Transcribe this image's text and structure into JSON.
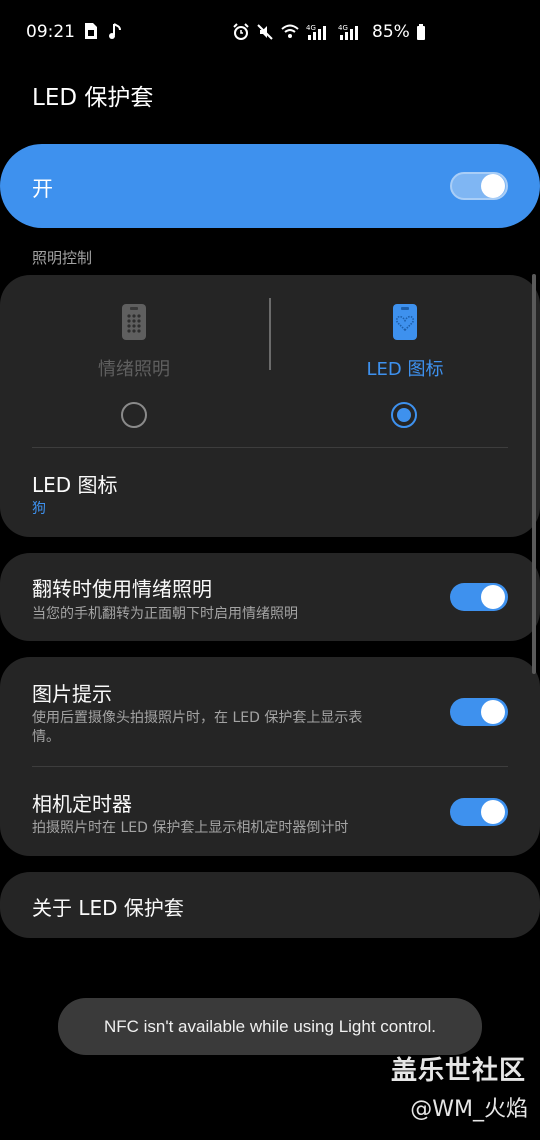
{
  "status_bar": {
    "time": "09:21",
    "battery_text": "85%",
    "left_icons": [
      "sim-card-icon",
      "music-note-icon"
    ],
    "right_icons": [
      "alarm-icon",
      "mute-icon",
      "wifi-icon",
      "4g-signal-icon",
      "4g-signal-icon",
      "battery-icon"
    ]
  },
  "page": {
    "title": "LED 保护套"
  },
  "master_switch": {
    "label": "开",
    "state": "on"
  },
  "lighting_section": {
    "header": "照明控制",
    "options": [
      {
        "label": "情绪照明",
        "selected": false
      },
      {
        "label": "LED 图标",
        "selected": true
      }
    ],
    "led_icon_row": {
      "title": "LED 图标",
      "value": "狗"
    }
  },
  "settings": [
    {
      "title": "翻转时使用情绪照明",
      "subtitle": "当您的手机翻转为正面朝下时启用情绪照明",
      "on": true
    },
    {
      "title": "图片提示",
      "subtitle_line1": "使用后置摄像头拍摄照片时，在 LED 保护套上显示表",
      "subtitle_line2": "情。",
      "on": true
    },
    {
      "title": "相机定时器",
      "subtitle": "拍摄照片时在 LED 保护套上显示相机定时器倒计时",
      "on": true
    }
  ],
  "about": {
    "label": "关于 LED 保护套"
  },
  "toast": {
    "text": "NFC isn't available while using Light control."
  },
  "watermark": {
    "line1": "盖乐世社区",
    "line2": "@WM_火焰"
  },
  "colors": {
    "accent": "#3e91ee",
    "card": "#252525",
    "background": "#000000",
    "toast": "#3a3a3a"
  }
}
